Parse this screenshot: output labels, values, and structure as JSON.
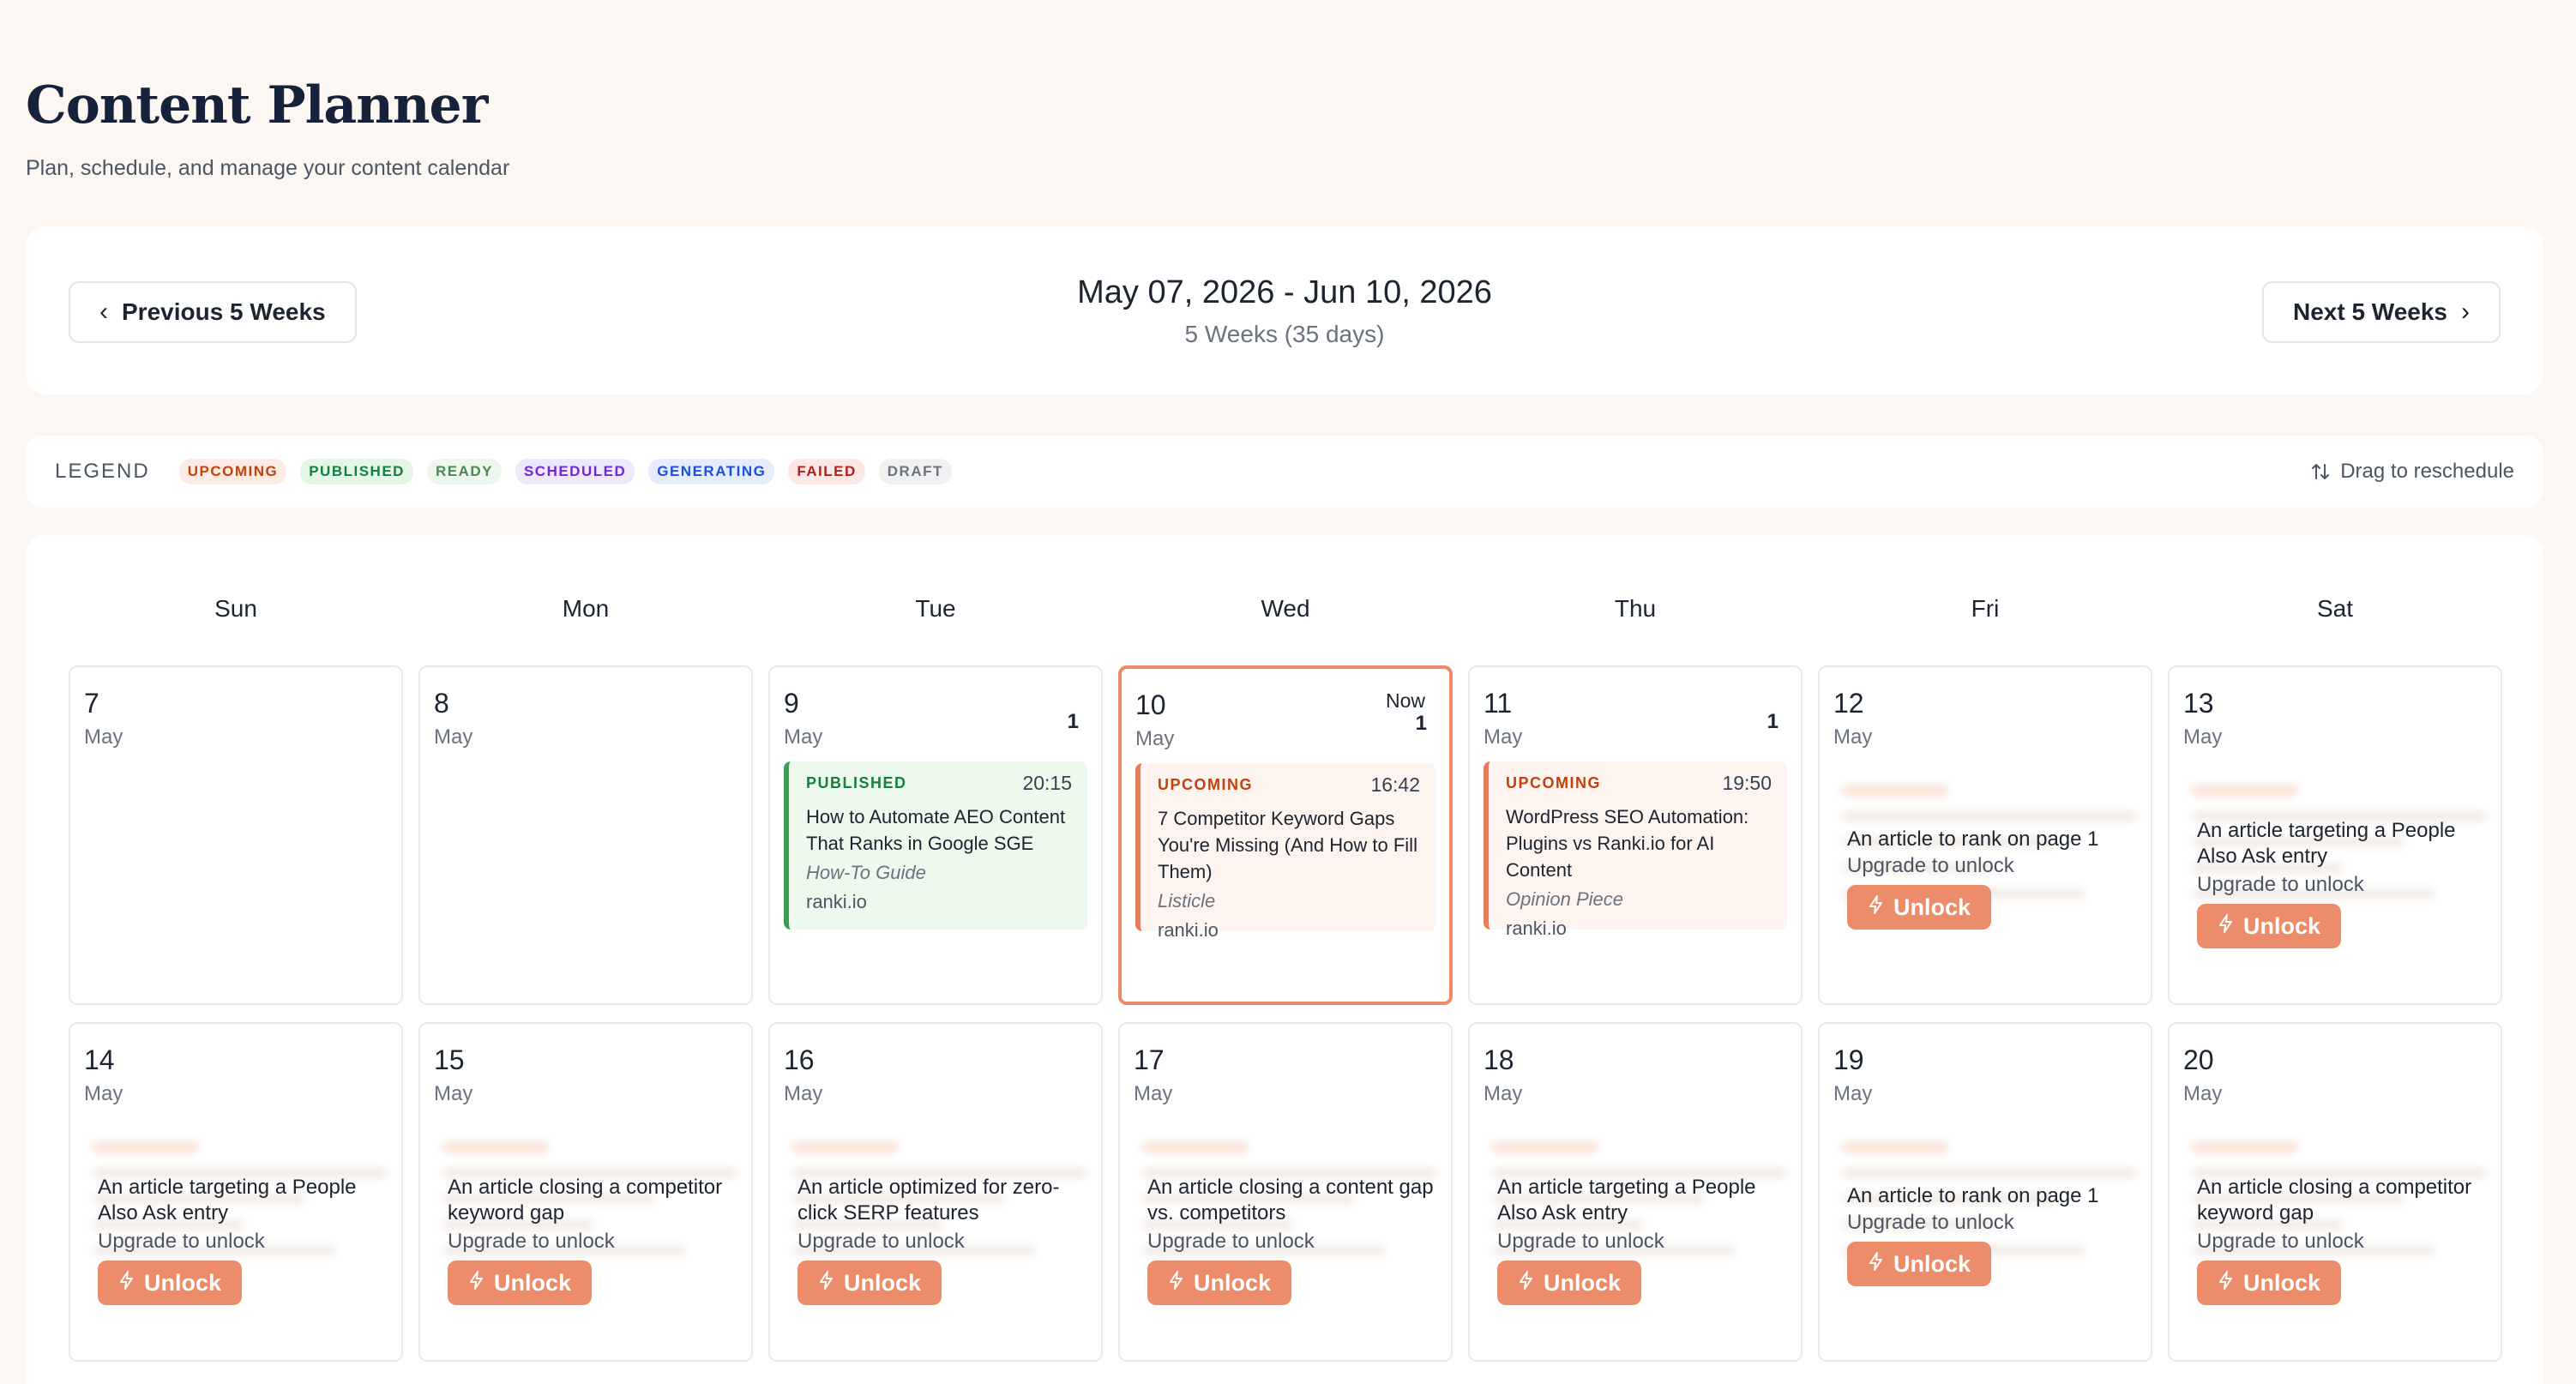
{
  "page": {
    "title": "Content Planner",
    "subtitle": "Plan, schedule, and manage your content calendar"
  },
  "nav": {
    "prev_label": "Previous 5 Weeks",
    "next_label": "Next 5 Weeks",
    "range": "May 07, 2026 - Jun 10, 2026",
    "range_sub": "5 Weeks (35 days)"
  },
  "legend": {
    "label": "LEGEND",
    "items": [
      "UPCOMING",
      "PUBLISHED",
      "READY",
      "SCHEDULED",
      "GENERATING",
      "FAILED",
      "DRAFT"
    ],
    "drag_hint": "Drag to reschedule"
  },
  "colors": {
    "accent": "#ec8c6b",
    "published": "#15803d",
    "upcoming": "#c2410c",
    "today_border": "#ee8a68"
  },
  "calendar": {
    "weekdays": [
      "Sun",
      "Mon",
      "Tue",
      "Wed",
      "Thu",
      "Fri",
      "Sat"
    ],
    "now_label": "Now",
    "upgrade_text": "Upgrade to unlock",
    "unlock_label": "Unlock",
    "days": [
      {
        "num": "7",
        "month": "May"
      },
      {
        "num": "8",
        "month": "May"
      },
      {
        "num": "9",
        "month": "May",
        "count": "1",
        "event": {
          "status": "PUBLISHED",
          "time": "20:15",
          "title": "How to Automate AEO Content That Ranks in Google SGE",
          "type": "How-To Guide",
          "site": "ranki.io"
        }
      },
      {
        "num": "10",
        "month": "May",
        "count": "1",
        "event": {
          "status": "UPCOMING",
          "time": "16:42",
          "title": "7 Competitor Keyword Gaps You're Missing (And How to Fill Them)",
          "type": "Listicle",
          "site": "ranki.io"
        }
      },
      {
        "num": "11",
        "month": "May",
        "count": "1",
        "event": {
          "status": "UPCOMING",
          "time": "19:50",
          "title": "WordPress SEO Automation: Plugins vs Ranki.io for AI Content",
          "type": "Opinion Piece",
          "site": "ranki.io"
        }
      },
      {
        "num": "12",
        "month": "May",
        "locked": "An article to rank on page 1"
      },
      {
        "num": "13",
        "month": "May",
        "locked": "An article targeting a People Also Ask entry"
      },
      {
        "num": "14",
        "month": "May",
        "locked": "An article targeting a People Also Ask entry"
      },
      {
        "num": "15",
        "month": "May",
        "locked": "An article closing a competitor keyword gap"
      },
      {
        "num": "16",
        "month": "May",
        "locked": "An article optimized for zero-click SERP features"
      },
      {
        "num": "17",
        "month": "May",
        "locked": "An article closing a content gap vs. competitors"
      },
      {
        "num": "18",
        "month": "May",
        "locked": "An article targeting a People Also Ask entry"
      },
      {
        "num": "19",
        "month": "May",
        "locked": "An article to rank on page 1"
      },
      {
        "num": "20",
        "month": "May",
        "locked": "An article closing a competitor keyword gap"
      }
    ]
  }
}
